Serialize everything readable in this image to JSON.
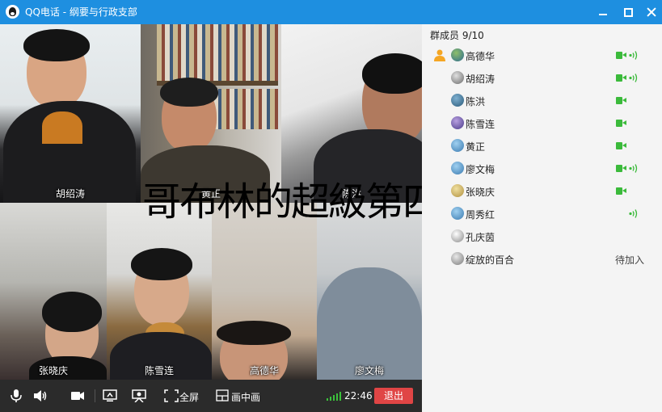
{
  "window": {
    "title": "QQ电话 - 纲要与行政支部"
  },
  "overlay_caption": "哥布林的超級第四集",
  "videos": [
    {
      "name": "胡绍涛"
    },
    {
      "name": "黄正"
    },
    {
      "name": "陈洪"
    },
    {
      "name": "张晓庆"
    },
    {
      "name": "陈雪连"
    },
    {
      "name": "高德华"
    },
    {
      "name": "廖文梅"
    }
  ],
  "toolbar": {
    "fullscreen_label": "全屏",
    "pip_label": "画中画",
    "time": "22:46",
    "exit_label": "退出"
  },
  "members": {
    "header": "群成员 9/10",
    "list": [
      {
        "name": "高德华",
        "video": true,
        "mic": true,
        "host": true
      },
      {
        "name": "胡绍涛",
        "video": true,
        "mic": true
      },
      {
        "name": "陈洪",
        "video": true,
        "mic": false
      },
      {
        "name": "陈雪连",
        "video": true,
        "mic": false
      },
      {
        "name": "黄正",
        "video": true,
        "mic": false
      },
      {
        "name": "廖文梅",
        "video": true,
        "mic": true
      },
      {
        "name": "张晓庆",
        "video": true,
        "mic": false
      },
      {
        "name": "周秀红",
        "video": false,
        "mic": true
      },
      {
        "name": "孔庆茵",
        "video": false,
        "mic": false
      },
      {
        "name": "绽放的百合",
        "video": false,
        "mic": false,
        "status": "待加入"
      }
    ]
  },
  "colors": {
    "titlebar": "#1e8fe0",
    "accent_green": "#3bba3b",
    "exit_red": "#e04545"
  }
}
